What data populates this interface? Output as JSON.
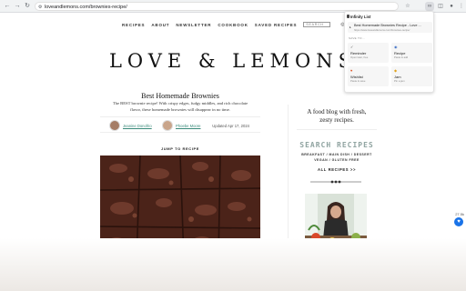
{
  "browser": {
    "url": "loveandlemons.com/brownies-recipe/",
    "back_icon": "←",
    "forward_icon": "→",
    "reload_icon": "↻"
  },
  "site": {
    "nav": [
      "RECIPES",
      "ABOUT",
      "NEWSLETTER",
      "COOKBOOK",
      "SAVED RECIPES"
    ],
    "search_label": "SEARCH",
    "logo": "LOVE & LEMONS"
  },
  "post": {
    "title": "Best Homemade Brownies",
    "description": "The BEST brownie recipe! With crispy edges, fudgy middles, and rich chocolate flavor, these homemade brownies will disappear in no time.",
    "author1": "Jeanine Donofrio",
    "author2": "Phoebe Moore",
    "updated": "Updated Apr 17, 2024",
    "jump": "JUMP TO RECIPE"
  },
  "sidebar": {
    "tagline": "A food blog with fresh, zesty recipes.",
    "search_heading": "SEARCH RECIPES",
    "filters_line1": "BREAKFAST / MAIN DISH / DESSERT",
    "filters_line2": "VEGAN / GLUTEN FREE",
    "all_recipes": "ALL RECIPES >>"
  },
  "floating": {
    "count": "27.5k"
  },
  "popup": {
    "title": "Infinity List",
    "page_title": "Best Homemade Brownies Recipe - Love ...",
    "page_url": "https://www.loveandlemons.com/brownies-recipe/",
    "save_to": "SAVE TO...",
    "destinations": [
      {
        "icon": "✓",
        "name": "Reminder",
        "desc": "Open later, free",
        "color": "#444444"
      },
      {
        "icon": "◉",
        "name": "Recipe",
        "desc": "Paste & add",
        "color": "#3d6fc4"
      },
      {
        "icon": "♥",
        "name": "Wishlist",
        "desc": "Paste & save",
        "color": "#e05a2b"
      },
      {
        "icon": "◆",
        "name": "Jam",
        "desc": "Pin a jam",
        "color": "#e0a21b"
      }
    ]
  }
}
